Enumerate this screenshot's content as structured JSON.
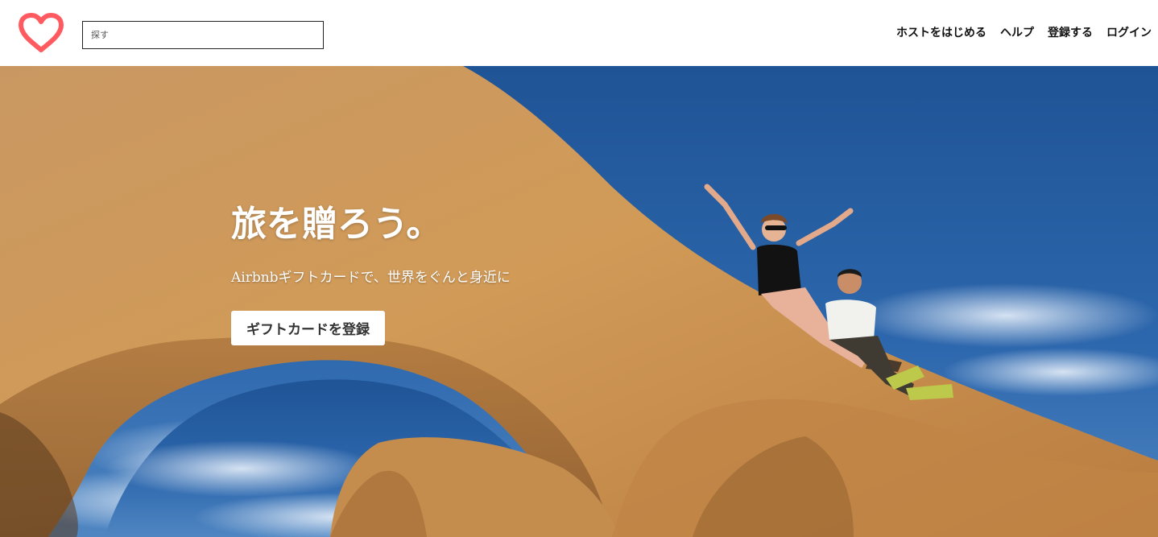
{
  "header": {
    "logo_icon": "heart-icon",
    "logo_color": "#FF5A5F",
    "search": {
      "placeholder": "探す",
      "value": ""
    },
    "nav": [
      {
        "label": "ホストをはじめる"
      },
      {
        "label": "ヘルプ"
      },
      {
        "label": "登録する"
      },
      {
        "label": "ログイン"
      }
    ]
  },
  "hero": {
    "title": "旅を贈ろう。",
    "subtitle": "Airbnbギフトカードで、世界をぐんと身近に",
    "cta_label": "ギフトカードを登録",
    "sky_color": "#2a5ea0",
    "rock_color": "#c98f4d"
  }
}
